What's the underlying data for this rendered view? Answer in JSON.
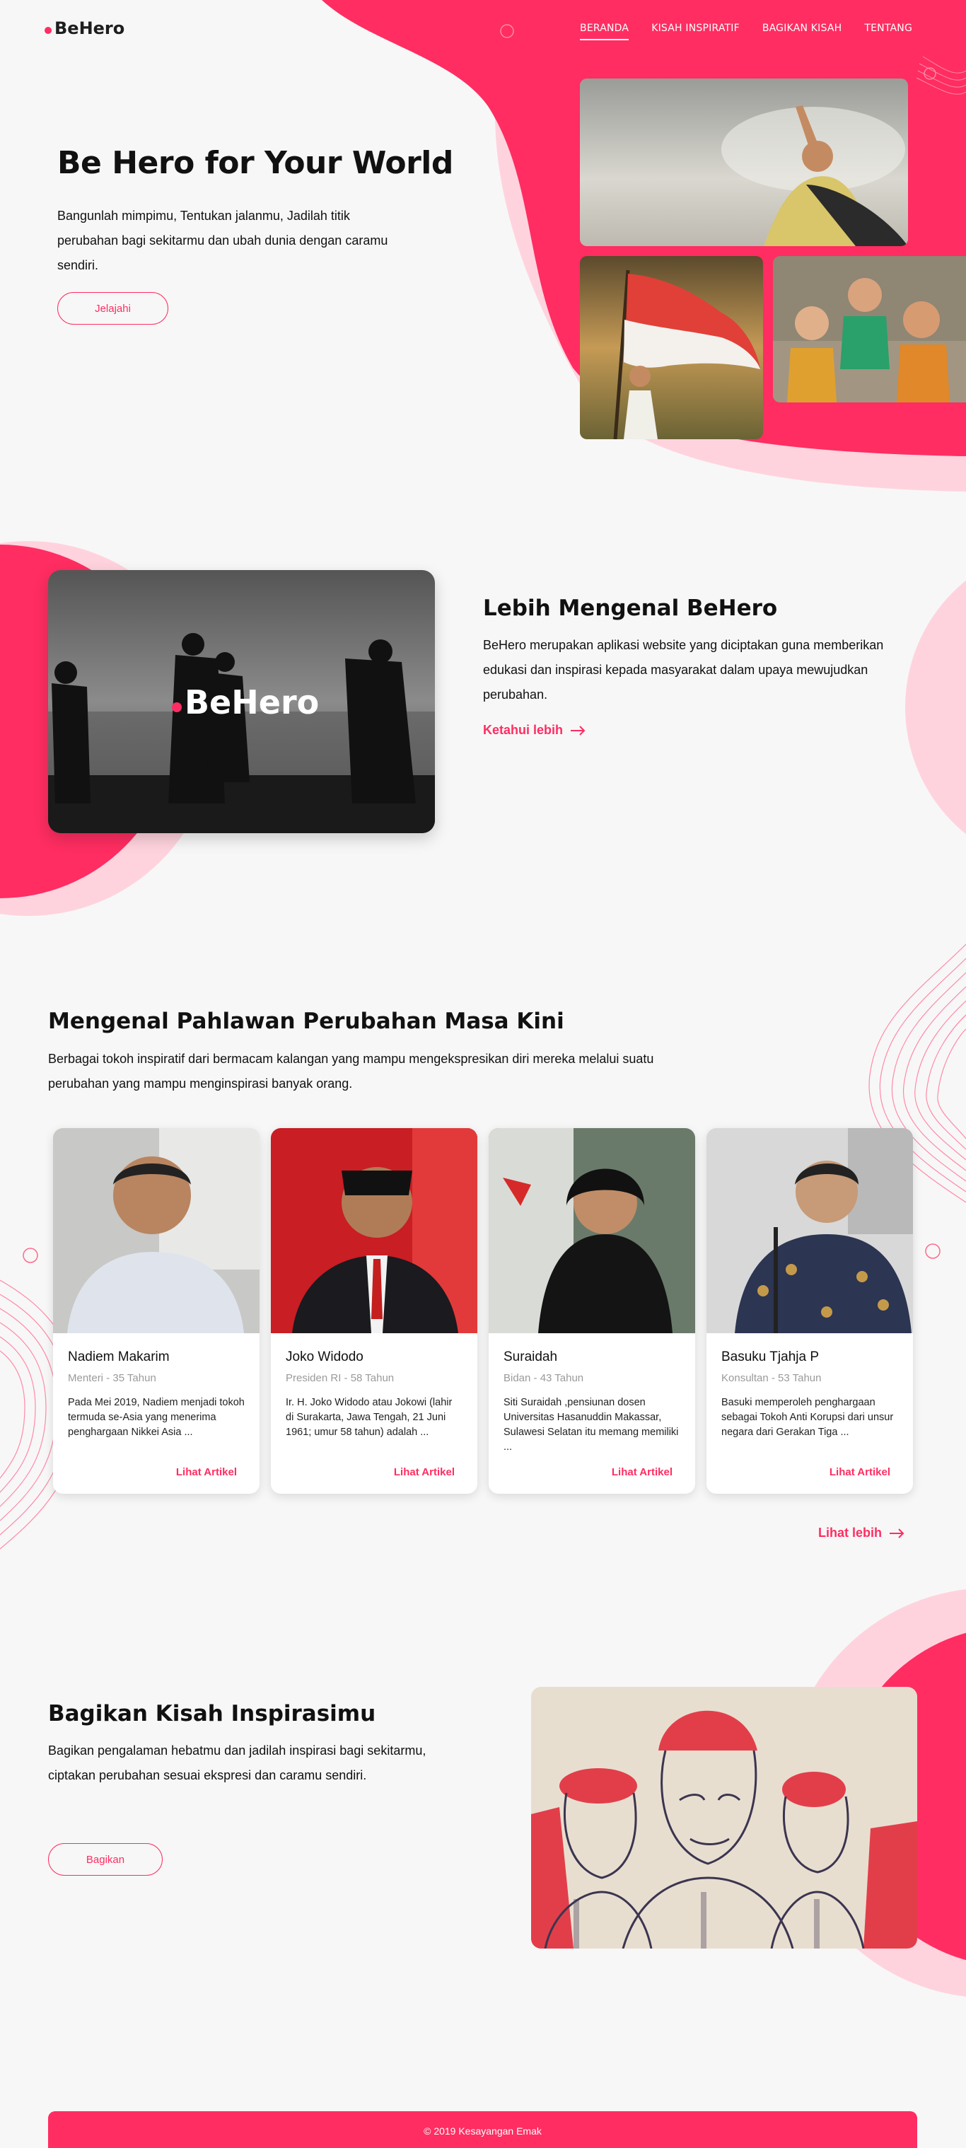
{
  "brand": {
    "name": "BeHero",
    "accent": "#ff2d61",
    "light_accent": "#ffd3de"
  },
  "nav": {
    "items": [
      {
        "label": "BERANDA",
        "active": true
      },
      {
        "label": "KISAH INSPIRATIF",
        "active": false
      },
      {
        "label": "BAGIKAN KISAH",
        "active": false
      },
      {
        "label": "TENTANG",
        "active": false
      }
    ]
  },
  "hero": {
    "title": "Be Hero for Your World",
    "text": "Bangunlah mimpimu, Tentukan jalanmu, Jadilah titik perubahan bagi sekitarmu dan ubah dunia dengan caramu sendiri.",
    "button": "Jelajahi"
  },
  "about": {
    "image_brand": "BeHero",
    "title": "Lebih Mengenal BeHero",
    "text": "BeHero merupakan aplikasi website yang diciptakan guna memberikan edukasi dan inspirasi kepada masyarakat dalam upaya mewujudkan perubahan.",
    "link": "Ketahui lebih"
  },
  "heroes": {
    "title": "Mengenal Pahlawan Perubahan Masa Kini",
    "text": "Berbagai tokoh inspiratif dari bermacam kalangan yang mampu mengekspresikan diri mereka melalui suatu perubahan yang mampu menginspirasi banyak orang.",
    "cards": [
      {
        "name": "Nadiem Makarim",
        "role": "Menteri - 35 Tahun",
        "desc": "Pada Mei 2019, Nadiem menjadi tokoh termuda se-Asia yang menerima penghargaan Nikkei Asia ...",
        "link": "Lihat Artikel"
      },
      {
        "name": "Joko Widodo",
        "role": "Presiden RI - 58 Tahun",
        "desc": "Ir. H. Joko Widodo atau Jokowi (lahir di Surakarta, Jawa Tengah, 21 Juni 1961; umur 58 tahun) adalah ...",
        "link": "Lihat Artikel"
      },
      {
        "name": "Suraidah",
        "role": "Bidan - 43 Tahun",
        "desc": "Siti Suraidah ,pensiunan dosen Universitas Hasanuddin Makassar, Sulawesi Selatan itu memang memiliki ...",
        "link": "Lihat Artikel"
      },
      {
        "name": "Basuku Tjahja P",
        "role": "Konsultan - 53 Tahun",
        "desc": "Basuki memperoleh penghargaan sebagai Tokoh Anti Korupsi dari unsur negara dari Gerakan Tiga ...",
        "link": "Lihat Artikel"
      }
    ],
    "more": "Lihat lebih"
  },
  "share": {
    "title": "Bagikan Kisah Inspirasimu",
    "text": "Bagikan pengalaman hebatmu dan jadilah inspirasi bagi sekitarmu, ciptakan perubahan sesuai ekspresi dan caramu sendiri.",
    "button": "Bagikan"
  },
  "footer": {
    "text": "© 2019 Kesayangan Emak"
  }
}
